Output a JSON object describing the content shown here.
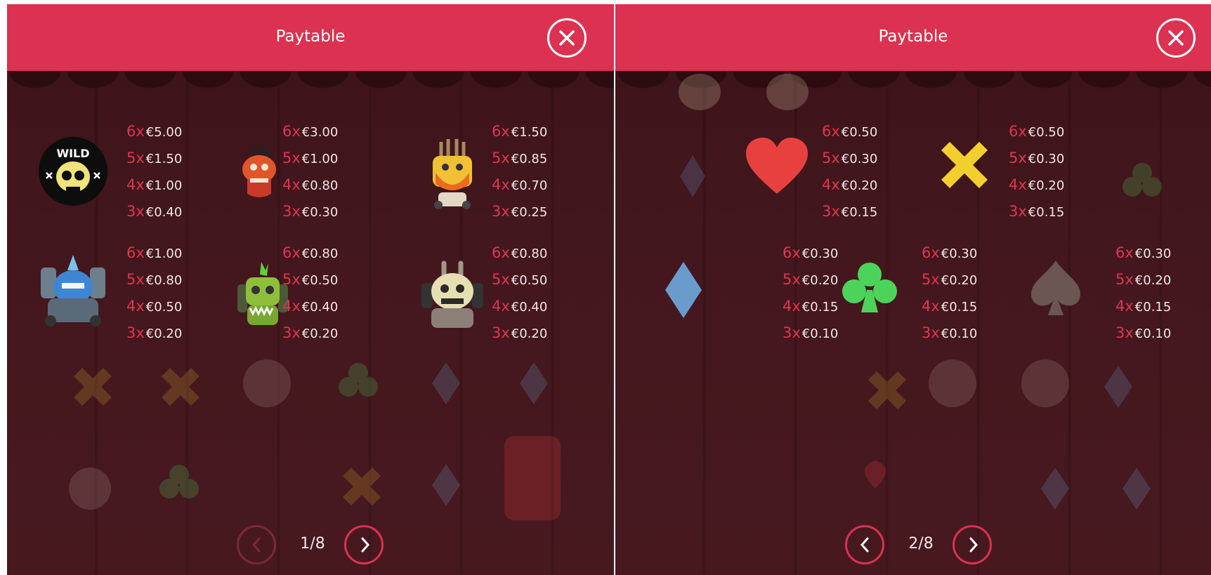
{
  "panels": [
    {
      "title": "Paytable",
      "page": "1/8",
      "symbols": [
        {
          "name": "wild",
          "pays": [
            [
              "6x",
              "€5.00"
            ],
            [
              "5x",
              "€1.50"
            ],
            [
              "4x",
              "€1.00"
            ],
            [
              "3x",
              "€0.40"
            ]
          ]
        },
        {
          "name": "red-monster",
          "pays": [
            [
              "6x",
              "€3.00"
            ],
            [
              "5x",
              "€1.00"
            ],
            [
              "4x",
              "€0.80"
            ],
            [
              "3x",
              "€0.30"
            ]
          ]
        },
        {
          "name": "orange-monster",
          "pays": [
            [
              "6x",
              "€1.50"
            ],
            [
              "5x",
              "€0.85"
            ],
            [
              "4x",
              "€0.70"
            ],
            [
              "3x",
              "€0.25"
            ]
          ]
        },
        {
          "name": "blue-monster",
          "pays": [
            [
              "6x",
              "€1.00"
            ],
            [
              "5x",
              "€0.80"
            ],
            [
              "4x",
              "€0.50"
            ],
            [
              "3x",
              "€0.20"
            ]
          ]
        },
        {
          "name": "green-monster",
          "pays": [
            [
              "6x",
              "€0.80"
            ],
            [
              "5x",
              "€0.50"
            ],
            [
              "4x",
              "€0.40"
            ],
            [
              "3x",
              "€0.20"
            ]
          ]
        },
        {
          "name": "skull-monster",
          "pays": [
            [
              "6x",
              "€0.80"
            ],
            [
              "5x",
              "€0.50"
            ],
            [
              "4x",
              "€0.40"
            ],
            [
              "3x",
              "€0.20"
            ]
          ]
        }
      ]
    },
    {
      "title": "Paytable",
      "page": "2/8",
      "symbols": [
        {
          "name": "heart",
          "pays": [
            [
              "6x",
              "€0.50"
            ],
            [
              "5x",
              "€0.30"
            ],
            [
              "4x",
              "€0.20"
            ],
            [
              "3x",
              "€0.15"
            ]
          ]
        },
        {
          "name": "cross",
          "pays": [
            [
              "6x",
              "€0.50"
            ],
            [
              "5x",
              "€0.30"
            ],
            [
              "4x",
              "€0.20"
            ],
            [
              "3x",
              "€0.15"
            ]
          ]
        },
        {
          "name": "diamond",
          "pays": [
            [
              "6x",
              "€0.30"
            ],
            [
              "5x",
              "€0.20"
            ],
            [
              "4x",
              "€0.15"
            ],
            [
              "3x",
              "€0.10"
            ]
          ]
        },
        {
          "name": "club",
          "pays": [
            [
              "6x",
              "€0.30"
            ],
            [
              "5x",
              "€0.20"
            ],
            [
              "4x",
              "€0.15"
            ],
            [
              "3x",
              "€0.10"
            ]
          ]
        },
        {
          "name": "spade",
          "pays": [
            [
              "6x",
              "€0.30"
            ],
            [
              "5x",
              "€0.20"
            ],
            [
              "4x",
              "€0.15"
            ],
            [
              "3x",
              "€0.10"
            ]
          ]
        }
      ]
    }
  ],
  "colors": {
    "header": "#dc3150",
    "multiplier": "#e03550",
    "heart": "#e8403f",
    "cross": "#f2cf2e",
    "diamond": "#6a9ccb",
    "club": "#4cd45a",
    "spade": "#6b5652"
  },
  "icons": {
    "close": "close-icon",
    "prev": "chevron-left-icon",
    "next": "chevron-right-icon"
  }
}
